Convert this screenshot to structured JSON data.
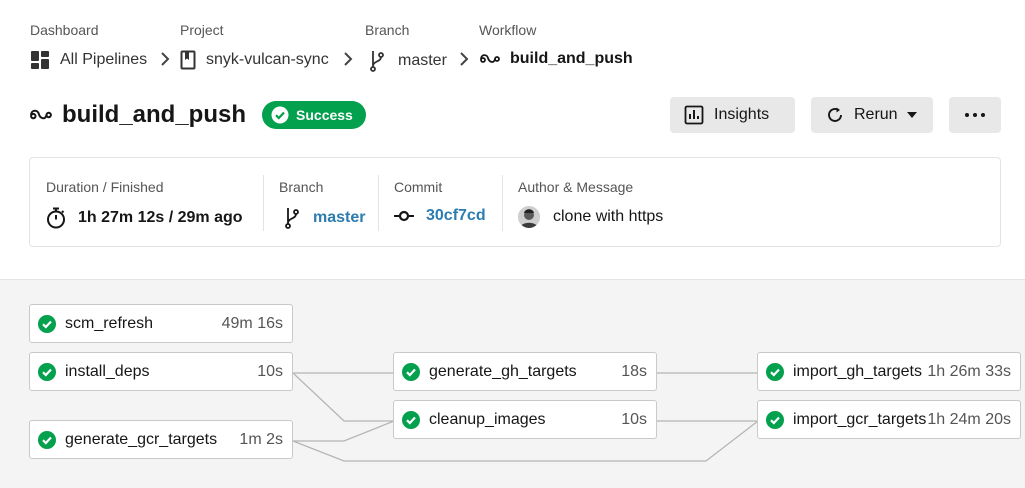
{
  "breadcrumb": {
    "dashboard": {
      "label": "Dashboard",
      "value": "All Pipelines"
    },
    "project": {
      "label": "Project",
      "value": "snyk-vulcan-sync"
    },
    "branch": {
      "label": "Branch",
      "value": "master"
    },
    "workflow": {
      "label": "Workflow",
      "value": "build_and_push"
    }
  },
  "header": {
    "title": "build_and_push",
    "status": "Success",
    "insights_label": "Insights",
    "rerun_label": "Rerun",
    "more_icon": "ellipsis-icon"
  },
  "summary": {
    "duration": {
      "label": "Duration / Finished",
      "value": "1h 27m 12s / 29m ago"
    },
    "branch": {
      "label": "Branch",
      "value": "master"
    },
    "commit": {
      "label": "Commit",
      "value": "30cf7cd"
    },
    "author": {
      "label": "Author & Message",
      "value": "clone with https"
    }
  },
  "jobs": [
    {
      "name": "scm_refresh",
      "duration": "49m 16s",
      "status": "success"
    },
    {
      "name": "install_deps",
      "duration": "10s",
      "status": "success"
    },
    {
      "name": "generate_gcr_targets",
      "duration": "1m 2s",
      "status": "success"
    },
    {
      "name": "generate_gh_targets",
      "duration": "18s",
      "status": "success"
    },
    {
      "name": "cleanup_images",
      "duration": "10s",
      "status": "success"
    },
    {
      "name": "import_gh_targets",
      "duration": "1h 26m 33s",
      "status": "success"
    },
    {
      "name": "import_gcr_targets",
      "duration": "1h 24m 20s",
      "status": "success"
    }
  ],
  "colors": {
    "success": "#03a04d",
    "link": "#2c7cb0",
    "button_bg": "#e8e8e8",
    "graph_bg": "#f4f4f4"
  }
}
